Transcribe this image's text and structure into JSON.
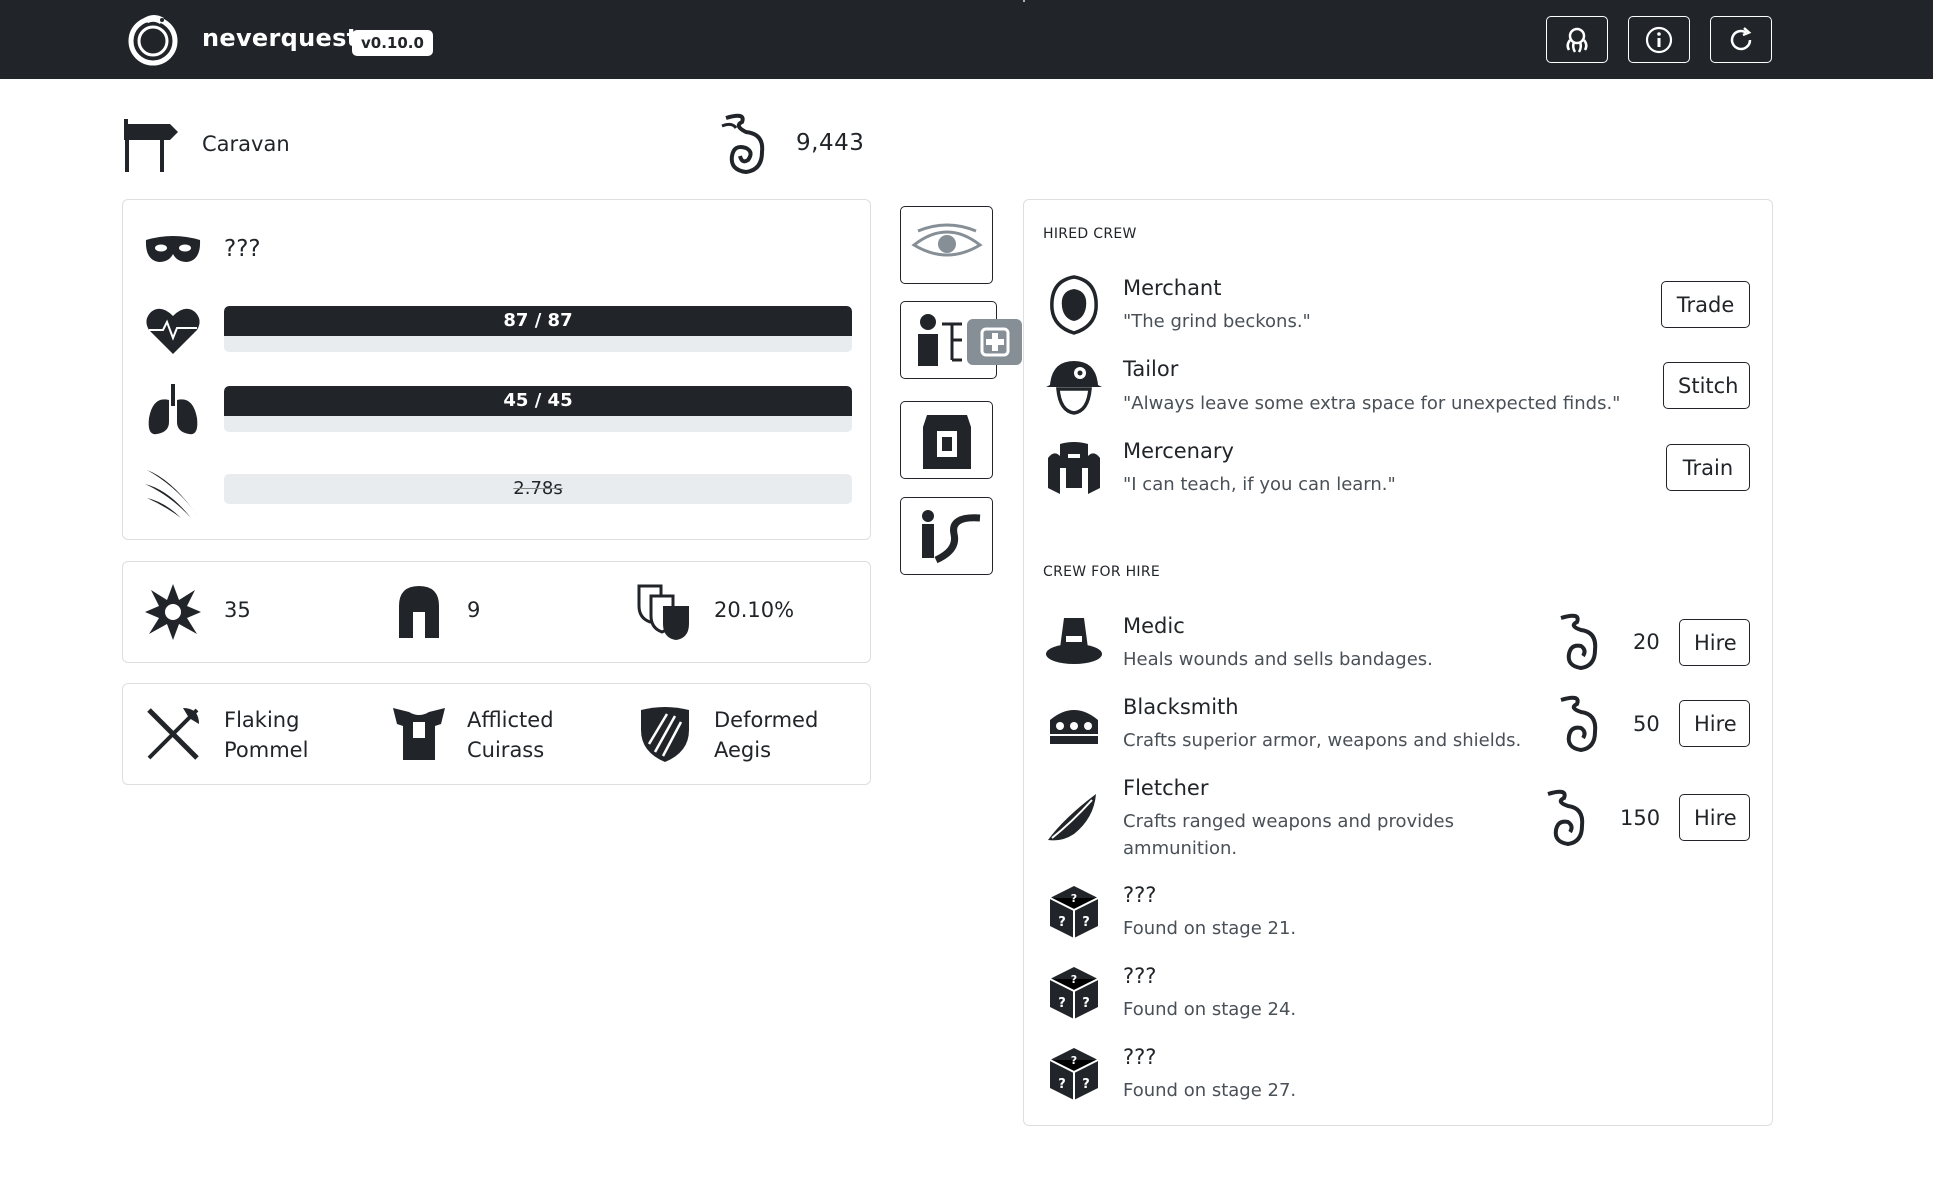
{
  "app": {
    "name": "neverquest",
    "version": "v0.10.0"
  },
  "location": {
    "name": "Caravan"
  },
  "essence": {
    "value": "9,443"
  },
  "character": {
    "name": "???",
    "health": {
      "label": "87 / 87",
      "fraction": 1.0
    },
    "stamina": {
      "label": "45 / 45",
      "fraction": 1.0
    },
    "attack_rate": {
      "label": "2.78s"
    }
  },
  "stats": {
    "damage": "35",
    "protection": "9",
    "block": "20.10%"
  },
  "gear": {
    "weapon": "Flaking Pommel",
    "armor": "Afflicted Cuirass",
    "shield": "Deformed Aegis"
  },
  "crew": {
    "hired_title": "Hired crew",
    "hired": [
      {
        "name": "Merchant",
        "quote": "\"The grind beckons.\"",
        "action": "Trade",
        "icon": "hooded-figure-icon"
      },
      {
        "name": "Tailor",
        "quote": "\"Always leave some extra space for unexpected finds.\"",
        "action": "Stitch",
        "icon": "flower-hat-icon"
      },
      {
        "name": "Mercenary",
        "quote": "\"I can teach, if you can learn.\"",
        "action": "Train",
        "icon": "helmet-warrior-icon"
      }
    ],
    "for_hire_title": "Crew for hire",
    "for_hire": [
      {
        "name": "Medic",
        "description": "Heals wounds and sells bandages.",
        "cost": "20",
        "action": "Hire",
        "icon": "pilgrim-hat-icon"
      },
      {
        "name": "Blacksmith",
        "description": "Crafts superior armor, weapons and shields.",
        "cost": "50",
        "action": "Hire",
        "icon": "anvil-helmet-icon"
      },
      {
        "name": "Fletcher",
        "description": "Crafts ranged weapons and provides ammunition.",
        "cost": "150",
        "action": "Hire",
        "icon": "feather-hat-icon"
      }
    ],
    "locked": [
      {
        "name": "???",
        "description": "Found on stage 21."
      },
      {
        "name": "???",
        "description": "Found on stage 24."
      },
      {
        "name": "???",
        "description": "Found on stage 27."
      }
    ]
  },
  "colors": {
    "navbar": "#212529",
    "bar_fill": "#212529",
    "bar_track": "#e9ecef",
    "badge": "#868e96"
  }
}
